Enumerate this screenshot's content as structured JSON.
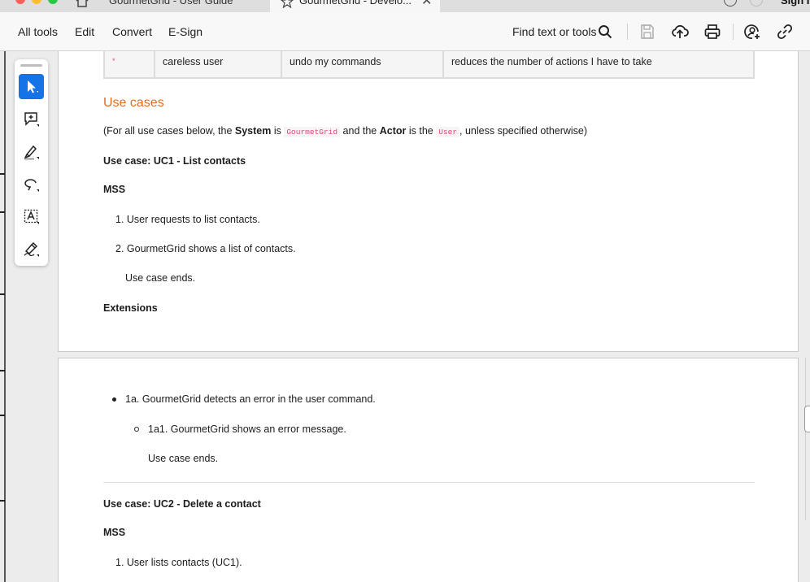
{
  "tabs": {
    "tab1_title": "GourmetGrid - User Guide",
    "tab2_title": "GourmetGrid - Develo...",
    "sign_in": "Sign I"
  },
  "toolbar": {
    "menu": [
      "All tools",
      "Edit",
      "Convert",
      "E-Sign"
    ],
    "find_label": "Find text or tools",
    "icons": [
      "save-icon",
      "cloud-upload-icon",
      "print-icon",
      "share-user-icon",
      "link-icon"
    ]
  },
  "palette": {
    "tools": [
      "select-pointer-icon",
      "add-comment-icon",
      "highlight-pen-icon",
      "draw-lasso-icon",
      "text-box-icon",
      "sign-pen-icon"
    ]
  },
  "doc": {
    "table_row": {
      "priority": "*",
      "as_a": "careless user",
      "i_want_to": "undo my commands",
      "so_that": "reduces the number of actions I have to take"
    },
    "heading_use_cases": "Use cases",
    "intro": {
      "pre": "(For all use cases below, the ",
      "system_label": "System",
      "is": " is ",
      "system_code": "GourmetGrid",
      "and_the": " and the ",
      "actor_label": "Actor",
      "is_the": " is the ",
      "actor_code": "User",
      "post": ", unless specified otherwise)"
    },
    "uc1": {
      "title": "Use case: UC1 - List contacts",
      "mss_label": "MSS",
      "steps": [
        "User requests to list contacts.",
        "GourmetGrid shows a list of contacts."
      ],
      "end": "Use case ends.",
      "extensions_label": "Extensions",
      "ext_1a": "1a. GourmetGrid detects an error in the user command.",
      "ext_1a1": "1a1. GourmetGrid shows an error message.",
      "ext_end": "Use case ends."
    },
    "uc2": {
      "title": "Use case: UC2 - Delete a contact",
      "mss_label": "MSS",
      "step1": "User lists contacts (UC1)."
    }
  },
  "colors": {
    "accent_blue": "#1473e6",
    "heading_orange": "#e36c1d",
    "code_pink": "#d9487e"
  }
}
